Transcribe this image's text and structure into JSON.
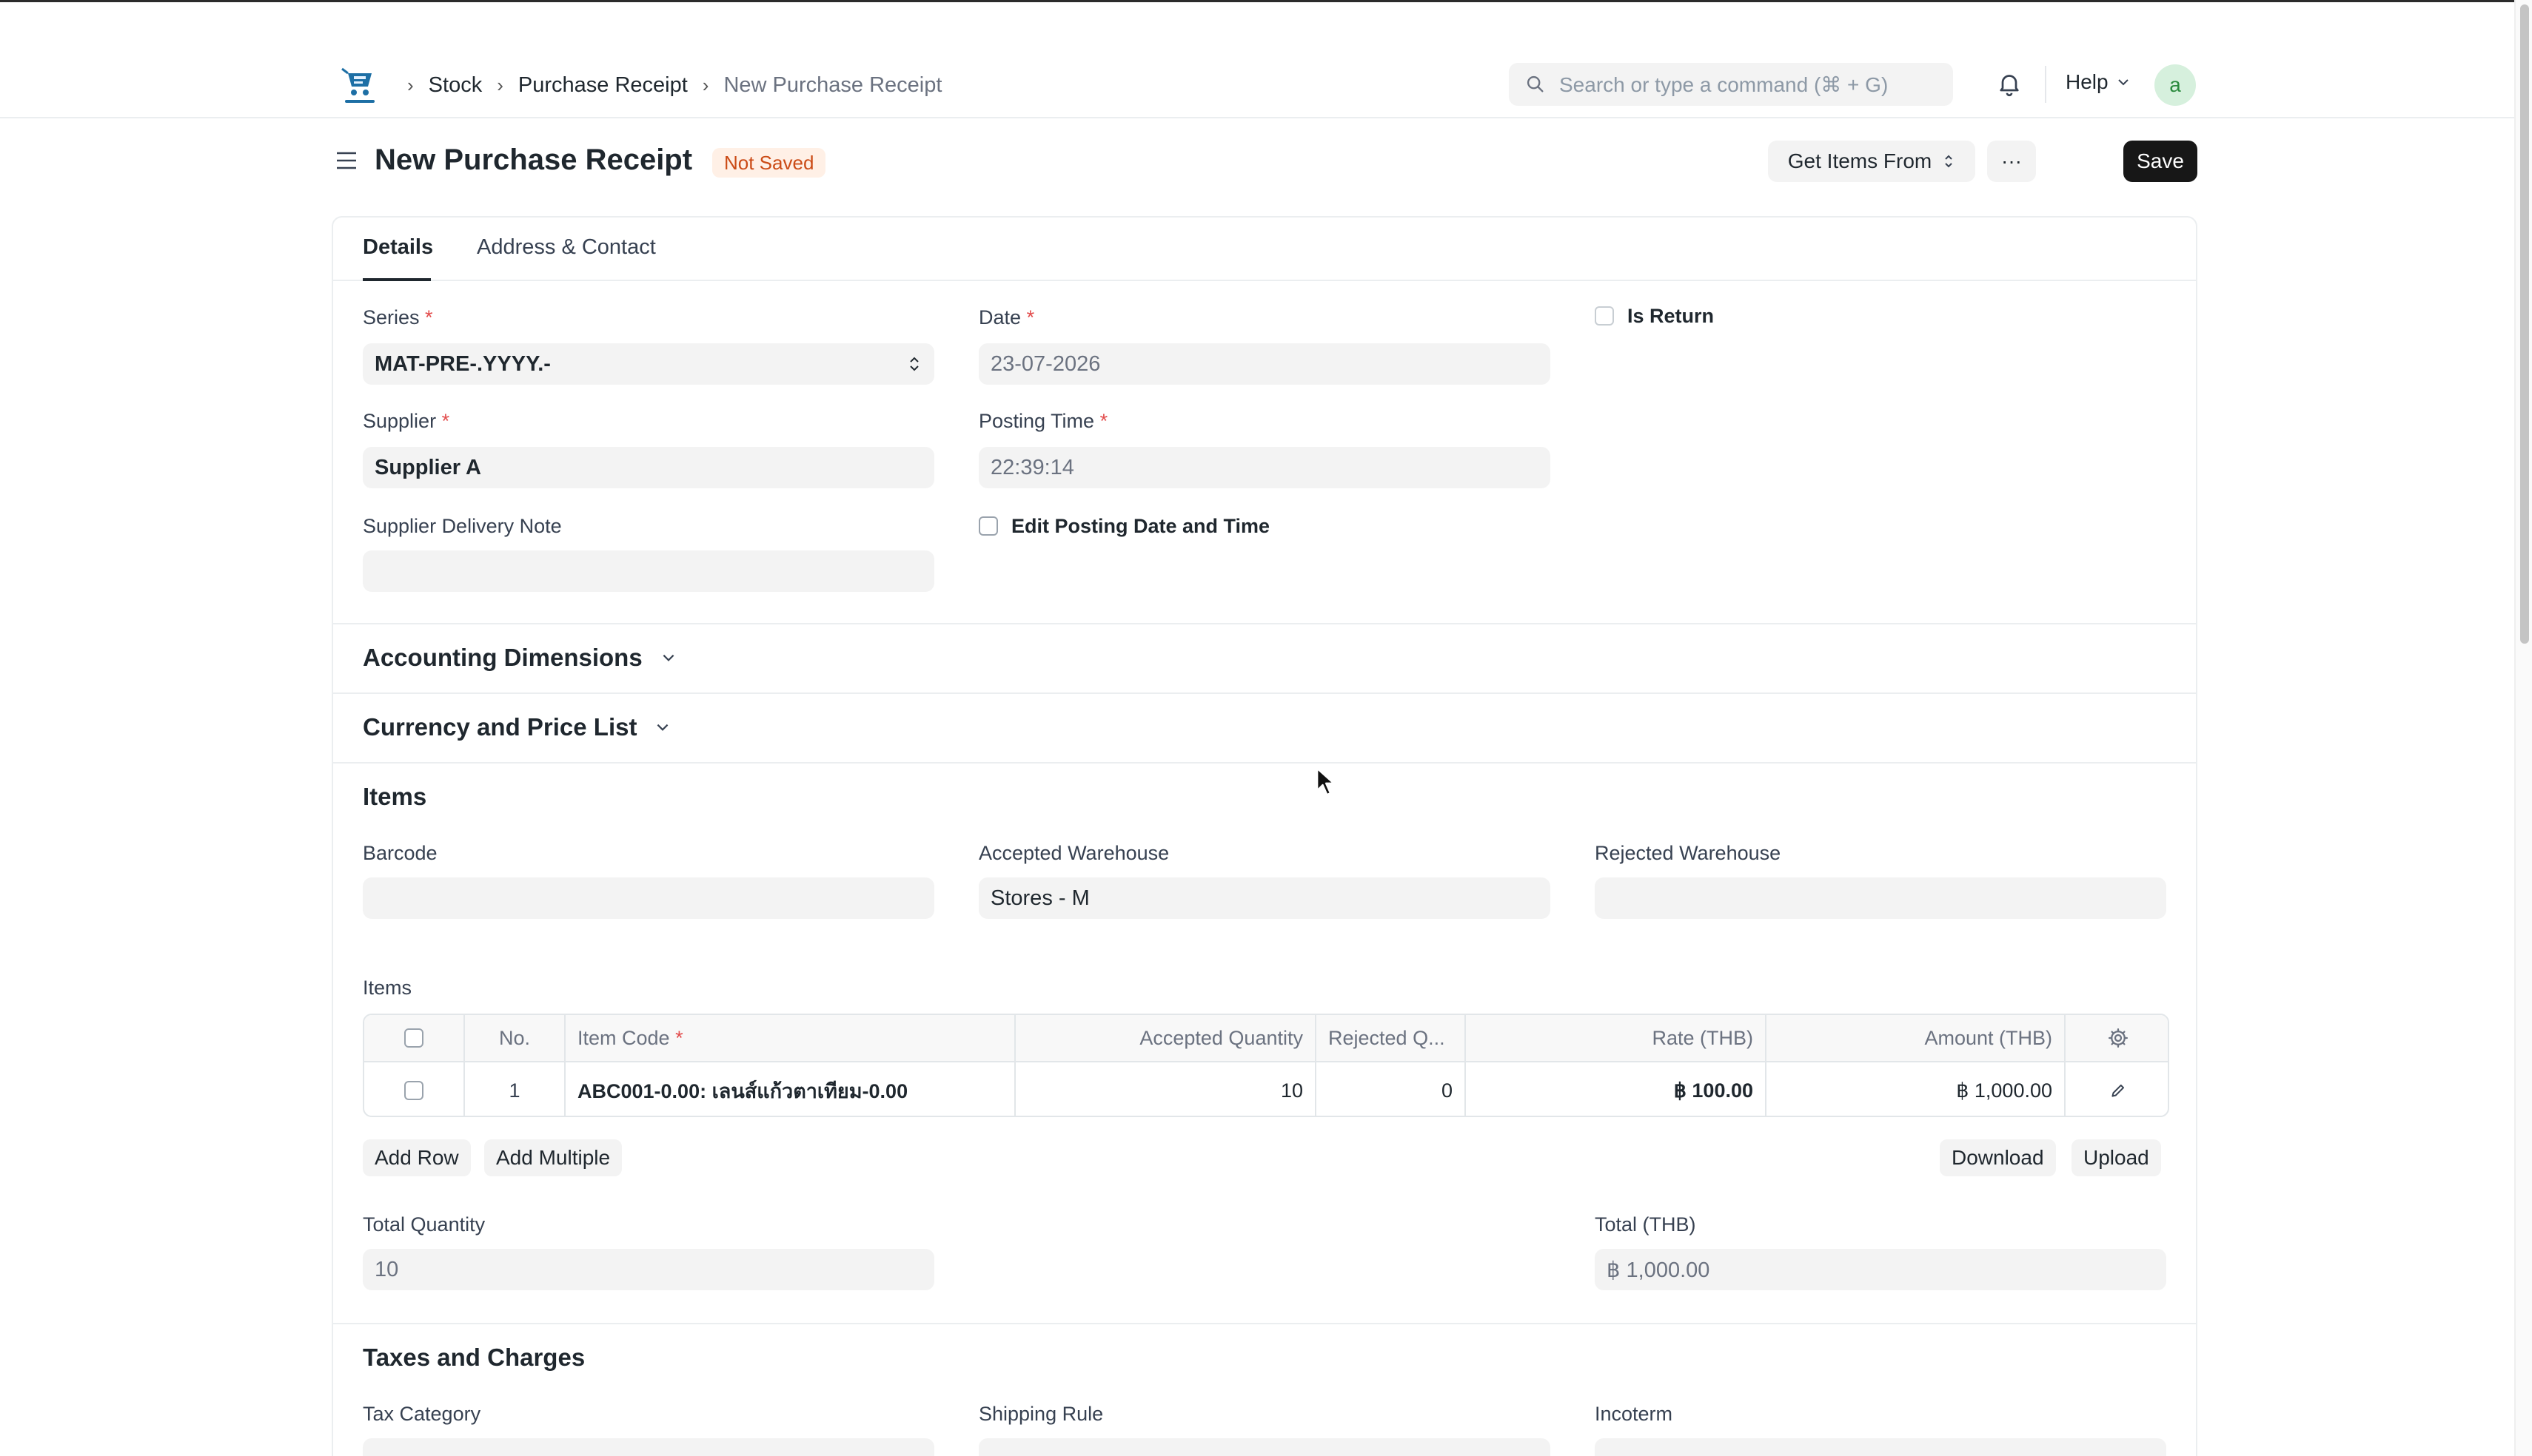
{
  "breadcrumbs": [
    "Stock",
    "Purchase Receipt",
    "New Purchase Receipt"
  ],
  "search": {
    "placeholder": "Search or type a command (⌘ + G)"
  },
  "header": {
    "help_label": "Help",
    "avatar_letter": "a"
  },
  "page": {
    "title": "New Purchase Receipt",
    "status": "Not Saved",
    "get_items_label": "Get Items From",
    "more_label": "···",
    "save_label": "Save"
  },
  "tabs": [
    "Details",
    "Address & Contact"
  ],
  "details": {
    "series_label": "Series",
    "series_value": "MAT-PRE-.YYYY.-",
    "date_label": "Date",
    "date_value": "23-07-2026",
    "is_return_label": "Is Return",
    "supplier_label": "Supplier",
    "supplier_value": "Supplier A",
    "posting_time_label": "Posting Time",
    "posting_time_value": "22:39:14",
    "delivery_note_label": "Supplier Delivery Note",
    "delivery_note_value": "",
    "edit_posting_label": "Edit Posting Date and Time"
  },
  "sections": {
    "accounting": "Accounting Dimensions",
    "currency": "Currency and Price List",
    "items": "Items",
    "taxes": "Taxes and Charges"
  },
  "items_section": {
    "barcode_label": "Barcode",
    "accepted_wh_label": "Accepted Warehouse",
    "accepted_wh_value": "Stores - M",
    "rejected_wh_label": "Rejected Warehouse",
    "table_label": "Items",
    "columns": [
      "No.",
      "Item Code",
      "Accepted Quantity",
      "Rejected Q...",
      "Rate (THB)",
      "Amount (THB)"
    ],
    "rows": [
      {
        "no": "1",
        "item_code": "ABC001-0.00: เลนส์แก้วตาเทียม-0.00",
        "accepted_qty": "10",
        "rejected_qty": "0",
        "rate": "฿ 100.00",
        "amount": "฿ 1,000.00"
      }
    ],
    "add_row": "Add Row",
    "add_multiple": "Add Multiple",
    "download": "Download",
    "upload": "Upload",
    "total_qty_label": "Total Quantity",
    "total_qty_value": "10",
    "total_label": "Total (THB)",
    "total_value": "฿ 1,000.00"
  },
  "taxes": {
    "tax_category_label": "Tax Category",
    "shipping_rule_label": "Shipping Rule",
    "incoterm_label": "Incoterm"
  },
  "colors": {
    "accent": "#171717",
    "status_bg": "#fff0e6",
    "status_fg": "#cb4b16",
    "required": "#e24c4c"
  }
}
